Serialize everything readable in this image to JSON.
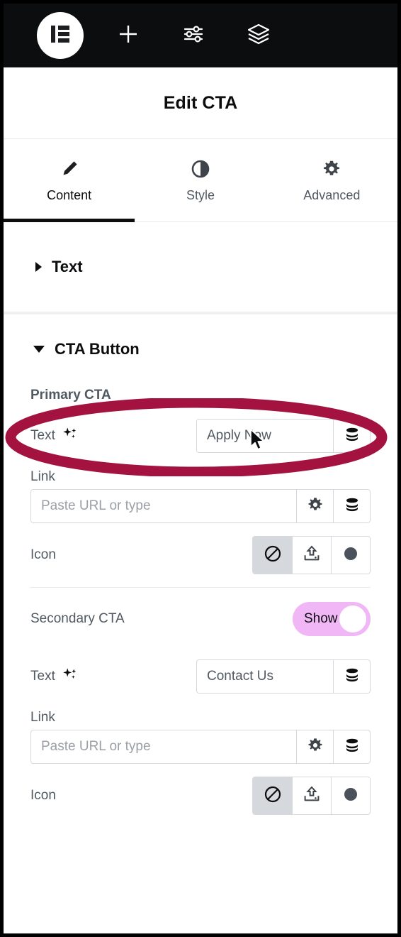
{
  "toolbar": {
    "logo": "elementor-logo",
    "buttons": [
      {
        "name": "add-element",
        "icon": "plus-icon"
      },
      {
        "name": "site-settings",
        "icon": "sliders-icon"
      },
      {
        "name": "navigator",
        "icon": "layers-icon"
      }
    ]
  },
  "header": {
    "title": "Edit CTA"
  },
  "tabs": [
    {
      "label": "Content",
      "icon": "pencil-icon",
      "active": true
    },
    {
      "label": "Style",
      "icon": "contrast-icon",
      "active": false
    },
    {
      "label": "Advanced",
      "icon": "gear-icon",
      "active": false
    }
  ],
  "sections": {
    "text": {
      "label": "Text",
      "expanded": false
    },
    "cta_button": {
      "label": "CTA Button",
      "expanded": true
    }
  },
  "primary_cta": {
    "group_label": "Primary CTA",
    "text": {
      "label": "Text",
      "ai_icon": "sparkles-icon",
      "value": "Apply Now",
      "dynamic_icon": "database-icon"
    },
    "link": {
      "label": "Link",
      "placeholder": "Paste URL or type",
      "value": "",
      "options_icon": "gear-icon",
      "dynamic_icon": "database-icon"
    },
    "icon": {
      "label": "Icon",
      "choices": [
        {
          "name": "icon-none",
          "icon": "circle-slash-icon",
          "selected": true
        },
        {
          "name": "icon-upload",
          "icon": "upload-icon",
          "selected": false
        },
        {
          "name": "icon-media",
          "icon": "filled-circle-icon",
          "selected": false
        }
      ]
    }
  },
  "secondary_cta": {
    "group_label": "Secondary CTA",
    "toggle": {
      "label": "Show",
      "on": true,
      "color": "#f1b6f6"
    },
    "text": {
      "label": "Text",
      "ai_icon": "sparkles-icon",
      "value": "Contact Us",
      "dynamic_icon": "database-icon"
    },
    "link": {
      "label": "Link",
      "placeholder": "Paste URL or type",
      "value": "",
      "options_icon": "gear-icon",
      "dynamic_icon": "database-icon"
    },
    "icon": {
      "label": "Icon",
      "choices": [
        {
          "name": "icon-none",
          "icon": "circle-slash-icon",
          "selected": true
        },
        {
          "name": "icon-upload",
          "icon": "upload-icon",
          "selected": false
        },
        {
          "name": "icon-media",
          "icon": "filled-circle-icon",
          "selected": false
        }
      ]
    }
  },
  "annotation": {
    "shape": "ellipse",
    "color": "#a4123f",
    "target": "primary-cta-text-row"
  },
  "cursor": {
    "type": "arrow-pointer"
  },
  "colors": {
    "toolbar_bg": "#0c0d0e",
    "panel_bg": "#ffffff",
    "label": "#515962",
    "border": "#d5d8dc",
    "selected_bg": "#d5d8dc",
    "toggle_on": "#f1b6f6",
    "annotation": "#a4123f"
  }
}
